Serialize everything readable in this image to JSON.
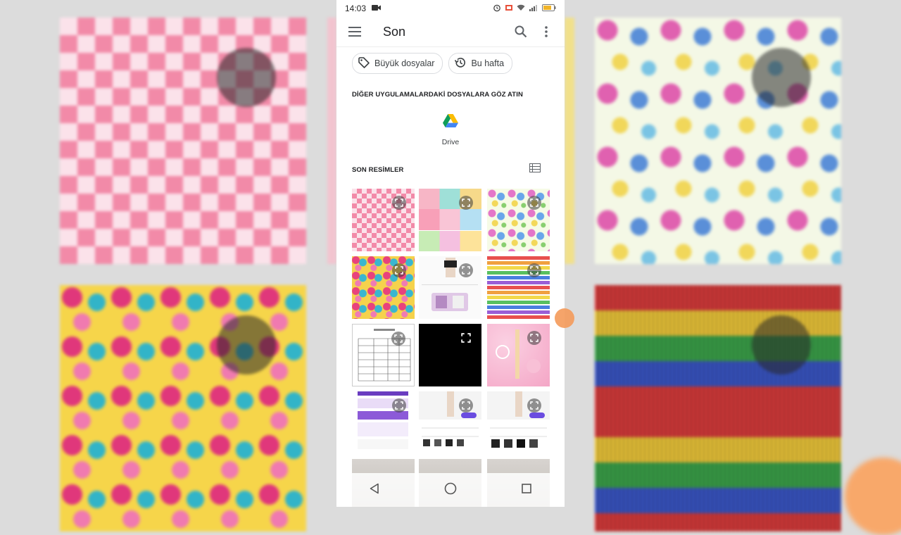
{
  "status_bar": {
    "time": "14:03"
  },
  "app_bar": {
    "title": "Son"
  },
  "chips": [
    {
      "label": "Büyük dosyalar",
      "icon": "tag-icon"
    },
    {
      "label": "Bu hafta",
      "icon": "history-icon"
    }
  ],
  "other_apps": {
    "title": "DİĞER UYGULAMALARDAKİ DOSYALARA GÖZ ATIN",
    "apps": [
      {
        "label": "Drive",
        "icon": "google-drive-icon"
      }
    ]
  },
  "recent_images": {
    "title": "SON RESİMLER",
    "view_toggle_icon": "list-view-icon"
  },
  "colors": {
    "accent": "#1a73e8",
    "chip_border": "#dadce0"
  }
}
